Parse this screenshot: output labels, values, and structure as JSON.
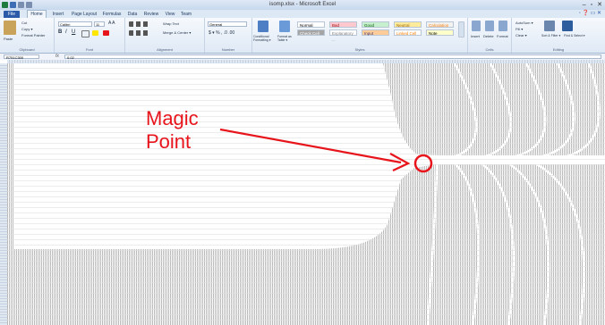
{
  "window": {
    "title": "isomp.xlsx - Microsoft Excel",
    "controls": [
      "–",
      "▫",
      "✕"
    ]
  },
  "tabs": [
    "File",
    "Home",
    "Insert",
    "Page Layout",
    "Formulas",
    "Data",
    "Review",
    "View",
    "Team"
  ],
  "active_tab": "Home",
  "ribbon": {
    "clipboard": {
      "paste": "Paste",
      "cut": "Cut",
      "copy": "Copy ▾",
      "format_painter": "Format Painter",
      "label": "Clipboard"
    },
    "font": {
      "name": "Calibri",
      "size": "11",
      "label": "Font"
    },
    "alignment": {
      "wrap": "Wrap Text",
      "merge": "Merge & Center ▾",
      "label": "Alignment"
    },
    "number": {
      "format": "General",
      "label": "Number"
    },
    "styles": {
      "conditional": "Conditional Formatting ▾",
      "format_table": "Format as Table ▾",
      "cells": [
        {
          "label": "Normal",
          "bg": "#ffffff",
          "fg": "#000000"
        },
        {
          "label": "Bad",
          "bg": "#ffc7ce",
          "fg": "#9c0006"
        },
        {
          "label": "Good",
          "bg": "#c6efce",
          "fg": "#006100"
        },
        {
          "label": "Neutral",
          "bg": "#ffeb9c",
          "fg": "#9c6500"
        },
        {
          "label": "Calculation",
          "bg": "#f2f2f2",
          "fg": "#fa7d00"
        },
        {
          "label": "Check Cell",
          "bg": "#a5a5a5",
          "fg": "#ffffff"
        },
        {
          "label": "Explanatory ...",
          "bg": "#ffffff",
          "fg": "#7f7f7f"
        },
        {
          "label": "Input",
          "bg": "#ffcc99",
          "fg": "#3f3f76"
        },
        {
          "label": "Linked Cell",
          "bg": "#ffffff",
          "fg": "#fa7d00"
        },
        {
          "label": "Note",
          "bg": "#ffffcc",
          "fg": "#000000"
        }
      ],
      "label": "Styles"
    },
    "cells_grp": {
      "insert": "Insert",
      "delete": "Delete",
      "format": "Format",
      "label": "Cells"
    },
    "editing": {
      "autosum": "AutoSum ▾",
      "fill": "Fill ▾",
      "clear": "Clear ▾",
      "sort": "Sort & Filter ▾",
      "find": "Find & Select ▾",
      "label": "Editing"
    }
  },
  "formula_bar": {
    "name_box": "R751C300",
    "fx": "fx",
    "value": "0.02"
  },
  "annotation": {
    "line1": "Magic",
    "line2": "Point",
    "color": "#e8141b"
  }
}
